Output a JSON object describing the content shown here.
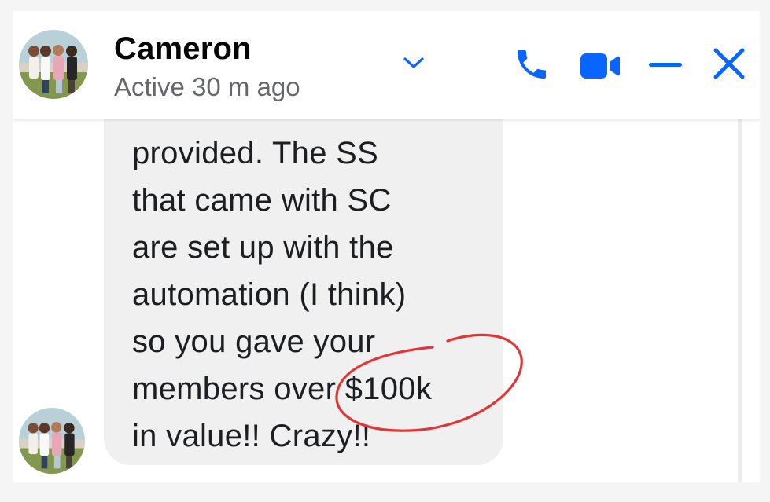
{
  "chat": {
    "contact_name": "Cameron",
    "status": "Active 30 m ago"
  },
  "header_icons": {
    "chevron": "chevron-down-icon",
    "call": "phone-icon",
    "video": "video-camera-icon",
    "minimize": "minimize-icon",
    "close": "close-icon",
    "accent_color": "#0866ff"
  },
  "message": {
    "text": "provided. The SS\nthat came with SC\nare set up with the\nautomation (I think)\nso you gave your\nmembers over $100k\nin value!! Crazy!!"
  },
  "annotation": {
    "color": "#e23535"
  }
}
